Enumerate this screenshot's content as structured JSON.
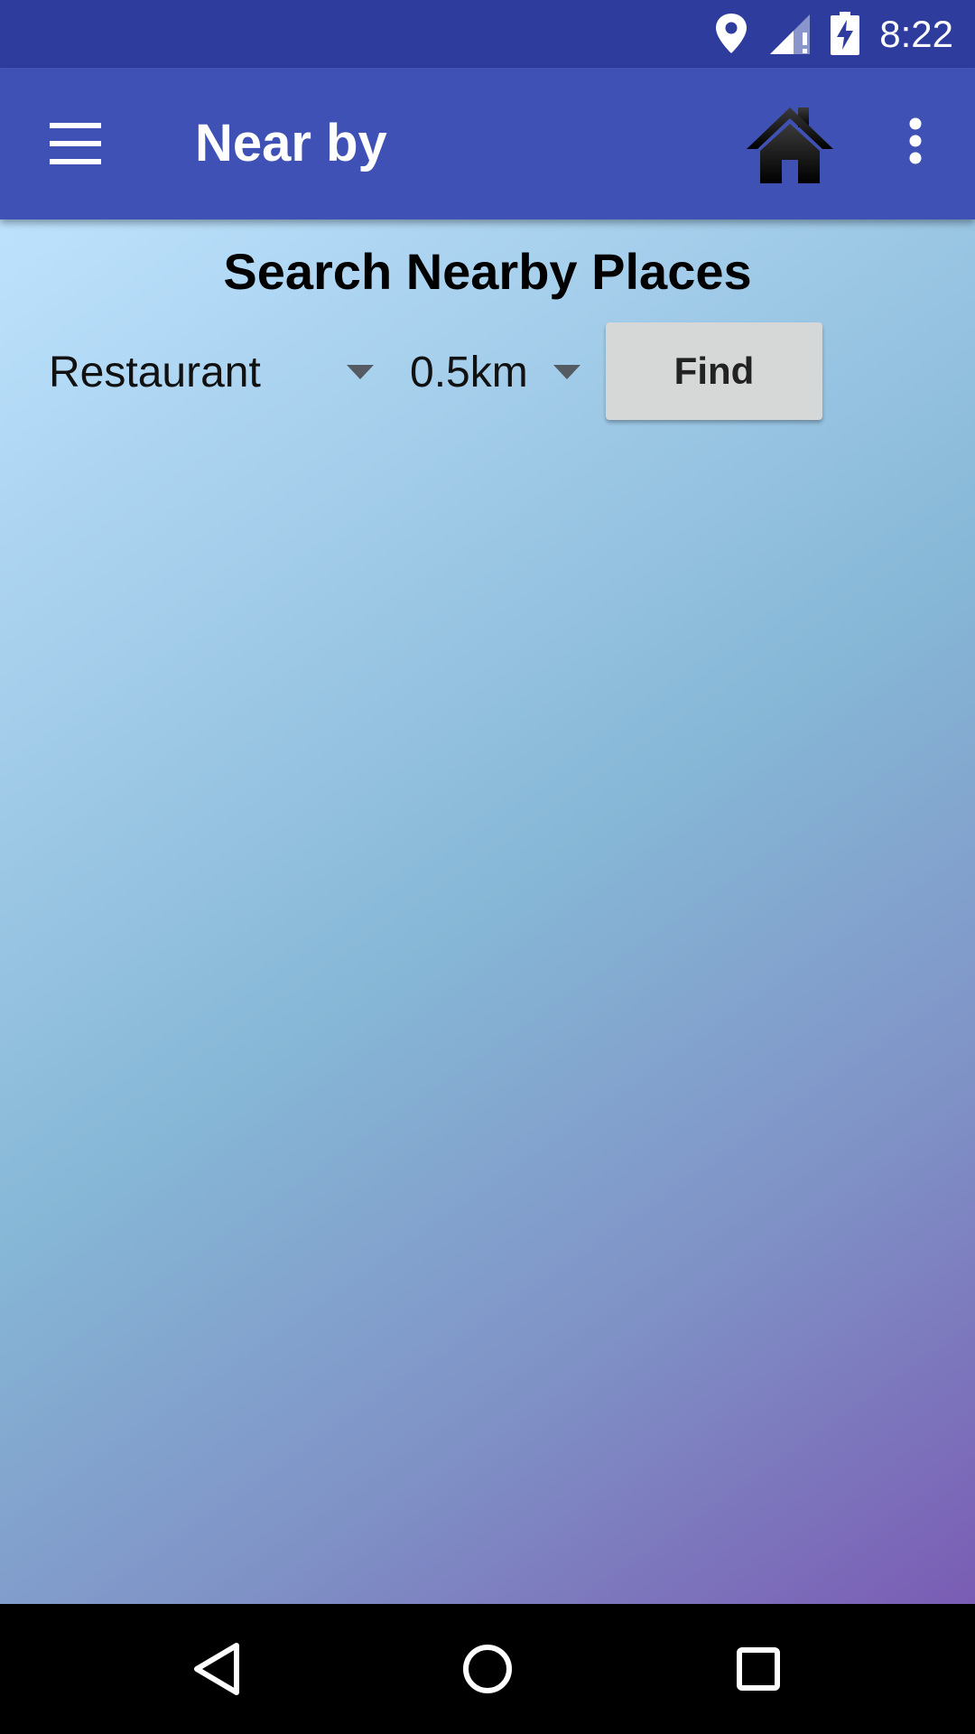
{
  "status_bar": {
    "time": "8:22",
    "icons": [
      "location-pin-icon",
      "signal-alert-icon",
      "battery-charging-icon"
    ]
  },
  "app_bar": {
    "title": "Near by",
    "icons": [
      "hamburger-menu-icon",
      "home-icon",
      "overflow-menu-icon"
    ],
    "color": "#3f51b5",
    "status_color": "#2e3c9e"
  },
  "search": {
    "title": "Search Nearby Places",
    "place_type": "Restaurant",
    "radius": "0.5km",
    "find_label": "Find"
  },
  "nav_bar": {
    "icons": [
      "back-icon",
      "home-circle-icon",
      "recents-icon"
    ]
  }
}
